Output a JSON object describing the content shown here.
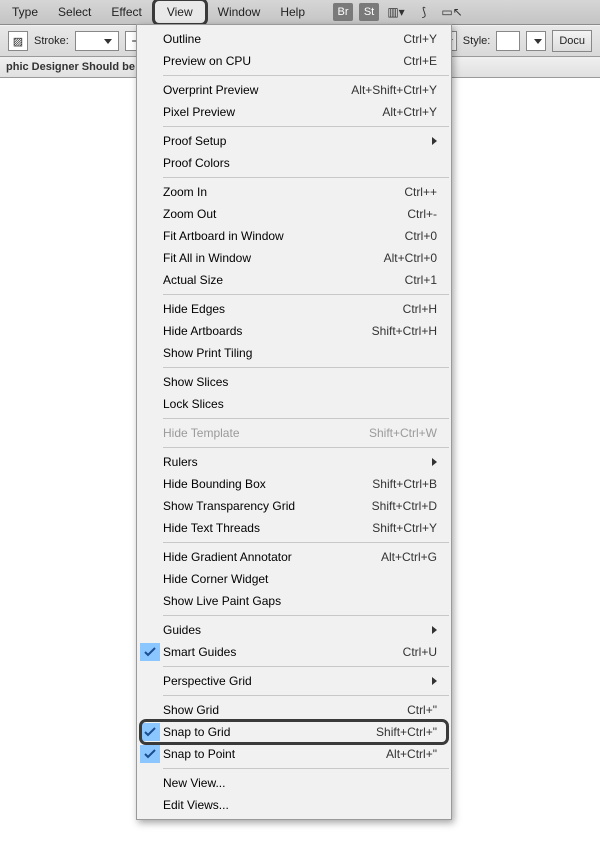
{
  "menubar": {
    "items": [
      {
        "label": "Type"
      },
      {
        "label": "Select"
      },
      {
        "label": "Effect"
      },
      {
        "label": "View",
        "active": true
      },
      {
        "label": "Window"
      },
      {
        "label": "Help"
      }
    ],
    "icons": [
      {
        "name": "bridge-icon",
        "glyph": "Br"
      },
      {
        "name": "stock-icon",
        "glyph": "St"
      },
      {
        "name": "arrange-documents-icon",
        "glyph": "▥▾"
      },
      {
        "name": "gpu-rocket-icon",
        "glyph": "⟆"
      },
      {
        "name": "screen-mode-icon",
        "glyph": "▭↖"
      }
    ]
  },
  "toolbar": {
    "stroke_label": "Stroke:",
    "style_label": "Style:",
    "doc_setup_label": "Docu"
  },
  "doc_tab": {
    "title": "phic Designer Should be Us"
  },
  "view_menu": {
    "groups": [
      [
        {
          "label": "Outline",
          "shortcut": "Ctrl+Y"
        },
        {
          "label": "Preview on CPU",
          "shortcut": "Ctrl+E"
        }
      ],
      [
        {
          "label": "Overprint Preview",
          "shortcut": "Alt+Shift+Ctrl+Y"
        },
        {
          "label": "Pixel Preview",
          "shortcut": "Alt+Ctrl+Y"
        }
      ],
      [
        {
          "label": "Proof Setup",
          "submenu": true
        },
        {
          "label": "Proof Colors"
        }
      ],
      [
        {
          "label": "Zoom In",
          "shortcut": "Ctrl++"
        },
        {
          "label": "Zoom Out",
          "shortcut": "Ctrl+-"
        },
        {
          "label": "Fit Artboard in Window",
          "shortcut": "Ctrl+0"
        },
        {
          "label": "Fit All in Window",
          "shortcut": "Alt+Ctrl+0"
        },
        {
          "label": "Actual Size",
          "shortcut": "Ctrl+1"
        }
      ],
      [
        {
          "label": "Hide Edges",
          "shortcut": "Ctrl+H"
        },
        {
          "label": "Hide Artboards",
          "shortcut": "Shift+Ctrl+H"
        },
        {
          "label": "Show Print Tiling"
        }
      ],
      [
        {
          "label": "Show Slices"
        },
        {
          "label": "Lock Slices"
        }
      ],
      [
        {
          "label": "Hide Template",
          "shortcut": "Shift+Ctrl+W",
          "disabled": true
        }
      ],
      [
        {
          "label": "Rulers",
          "submenu": true
        },
        {
          "label": "Hide Bounding Box",
          "shortcut": "Shift+Ctrl+B"
        },
        {
          "label": "Show Transparency Grid",
          "shortcut": "Shift+Ctrl+D"
        },
        {
          "label": "Hide Text Threads",
          "shortcut": "Shift+Ctrl+Y"
        }
      ],
      [
        {
          "label": "Hide Gradient Annotator",
          "shortcut": "Alt+Ctrl+G"
        },
        {
          "label": "Hide Corner Widget"
        },
        {
          "label": "Show Live Paint Gaps"
        }
      ],
      [
        {
          "label": "Guides",
          "submenu": true
        },
        {
          "label": "Smart Guides",
          "shortcut": "Ctrl+U",
          "checked": true
        }
      ],
      [
        {
          "label": "Perspective Grid",
          "submenu": true
        }
      ],
      [
        {
          "label": "Show Grid",
          "shortcut": "Ctrl+\""
        },
        {
          "label": "Snap to Grid",
          "shortcut": "Shift+Ctrl+\"",
          "checked": true,
          "highlight": true
        },
        {
          "label": "Snap to Point",
          "shortcut": "Alt+Ctrl+\"",
          "checked": true
        }
      ],
      [
        {
          "label": "New View..."
        },
        {
          "label": "Edit Views..."
        }
      ]
    ]
  }
}
